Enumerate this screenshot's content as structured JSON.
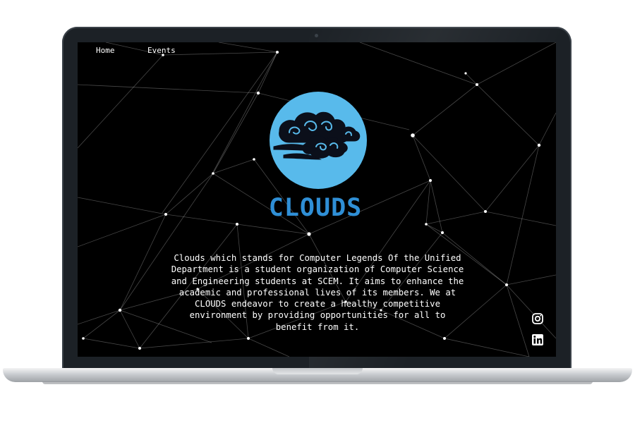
{
  "nav": {
    "home_label": "Home",
    "events_label": "Events"
  },
  "brand": {
    "name": "CLOUDS",
    "logo_circle_color": "#58baeb",
    "logo_text_color": "#2f8fd6"
  },
  "about": {
    "text": "Clouds which stands for Computer Legends Of the Unified Department is a student organization of Computer Science and Engineering students at SCEM. It aims to enhance the academic and professional lives of its members. We at CLOUDS endeavor to create a healthy competitive environment by providing opportunities for all to benefit from it."
  },
  "social": {
    "instagram_icon": "instagram-icon",
    "linkedin_icon": "linkedin-icon"
  },
  "colors": {
    "screen_bg": "#000000",
    "network_lines": "#ffffff",
    "text": "#ffffff"
  }
}
